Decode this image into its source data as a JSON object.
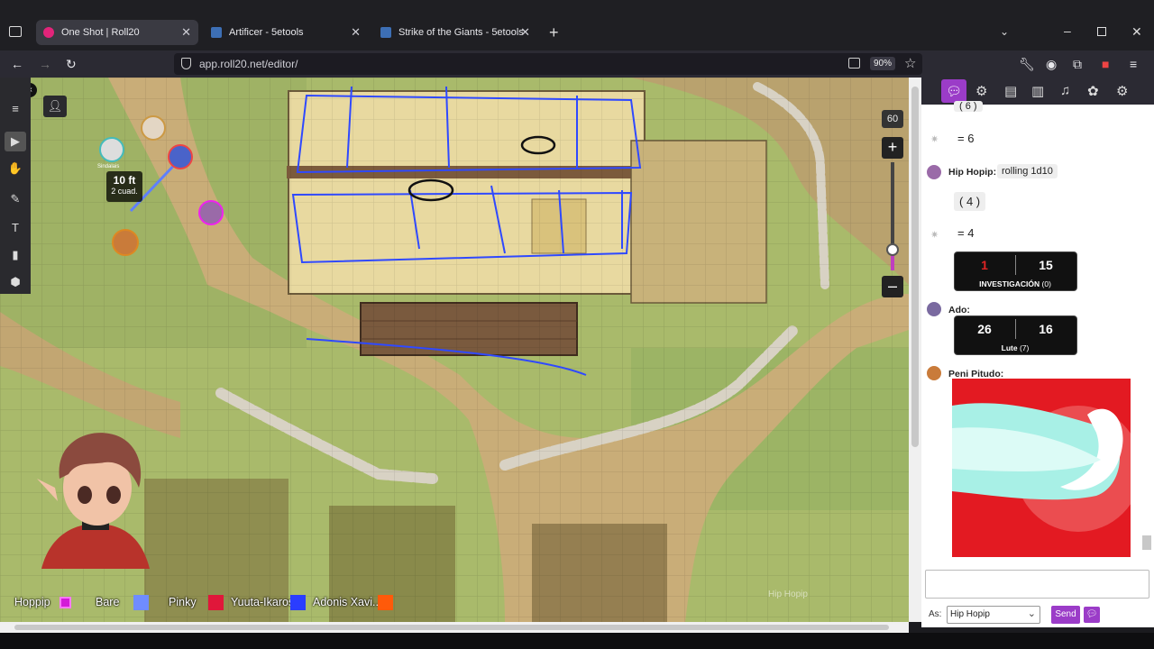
{
  "browser": {
    "tabs": [
      {
        "title": "One Shot | Roll20",
        "active": true
      },
      {
        "title": "Artificer - 5etools",
        "active": false
      },
      {
        "title": "Strike of the Giants - 5etools",
        "active": false
      }
    ],
    "url": "app.roll20.net/editor/",
    "zoom": "90%"
  },
  "vtt": {
    "zoom_level": "60",
    "measure_distance": "10 ft",
    "measure_squares": "2 cuad.",
    "token_label": "Sindalais",
    "colors": {
      "annotation": "#2f49ff",
      "grass": "#a8b86a",
      "path": "#c9b07a"
    }
  },
  "players": [
    {
      "name": "Hoppip",
      "color": "#d31bd8"
    },
    {
      "name": "Bare",
      "color": "#6f8cff"
    },
    {
      "name": "Pinky",
      "color": "#e0173a"
    },
    {
      "name": "Yuuta-Ikaros",
      "color": "#2a3dff"
    },
    {
      "name": "Adonis Xavi...",
      "color": "#ff5a0a"
    }
  ],
  "chat": {
    "partial_top": "( 6 )",
    "result_top": "= 6",
    "msg1_sender": "Hip Hopip:",
    "msg1_text": "rolling 1d10",
    "msg1_dice": "( 4 )",
    "msg1_result": "= 4",
    "roll1": {
      "left": "1",
      "right": "15",
      "label": "INVESTIGACIÓN",
      "mod": "(0)"
    },
    "msg2_sender": "Ado:",
    "roll2": {
      "left": "26",
      "right": "16",
      "label": "Lute",
      "mod": "(7)"
    },
    "msg3_sender": "Peni Pitudo:",
    "faded_label": "Hip Hopip",
    "as_label": "As:",
    "as_value": "Hip Hopip",
    "send_label": "Send"
  }
}
